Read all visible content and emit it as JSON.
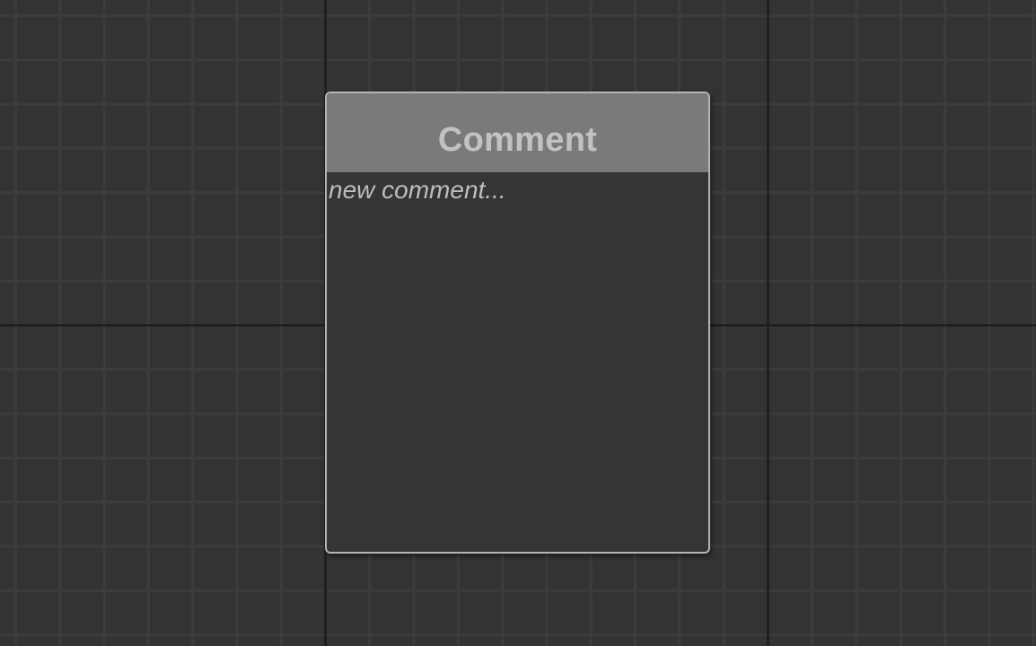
{
  "comment_node": {
    "title": "Comment",
    "body_text": "new comment..."
  },
  "colors": {
    "canvas_background": "#333333",
    "minor_grid_line": "#3c3c3c",
    "major_grid_line": "#1f1f1f",
    "node_header": "#7a7a7a",
    "node_border": "#b5b5b5",
    "node_body": "#353535",
    "text": "#c2c2c2"
  }
}
